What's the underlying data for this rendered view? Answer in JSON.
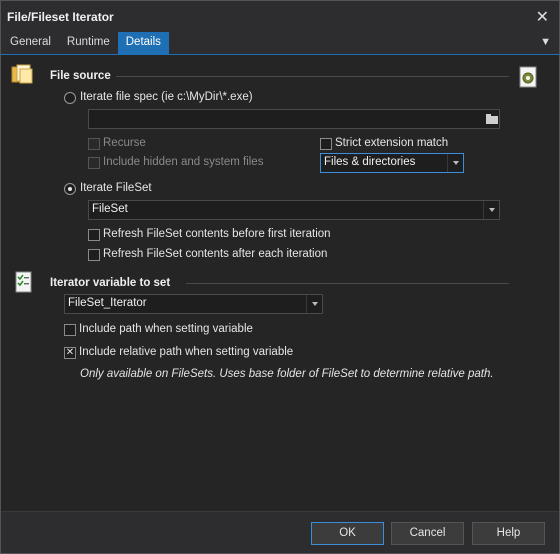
{
  "window": {
    "title": "File/Fileset Iterator",
    "close_glyph": "✕"
  },
  "tabs": [
    {
      "label": "General"
    },
    {
      "label": "Runtime"
    },
    {
      "label": "Details",
      "active": true
    }
  ],
  "tab_menu_glyph": "▼",
  "file_source": {
    "title": "File source",
    "icon": "folder-files-icon",
    "aside_icon": "gear-document-icon",
    "iterate_file_spec_label": "Iterate file spec (ie c:\\MyDir\\*.exe)",
    "file_spec_value": "",
    "recurse_label": "Recurse",
    "include_hidden_label": "Include hidden and system files",
    "strict_ext_label": "Strict extension match",
    "file_type_value": "Files & directories",
    "iterate_fileset_label": "Iterate FileSet",
    "fileset_value": "FileSet",
    "refresh_before_label": "Refresh FileSet contents before first iteration",
    "refresh_after_label": "Refresh FileSet contents after each iteration"
  },
  "iterator_variable": {
    "title": "Iterator variable to set",
    "icon": "checklist-icon",
    "variable_value": "FileSet_Iterator",
    "include_path_label": "Include path when setting variable",
    "include_relative_label": "Include relative path when setting variable",
    "include_relative_checked_glyph": "✕",
    "note": "Only available on FileSets. Uses base folder of FileSet to determine relative path."
  },
  "buttons": {
    "ok": "OK",
    "cancel": "Cancel",
    "help": "Help"
  }
}
